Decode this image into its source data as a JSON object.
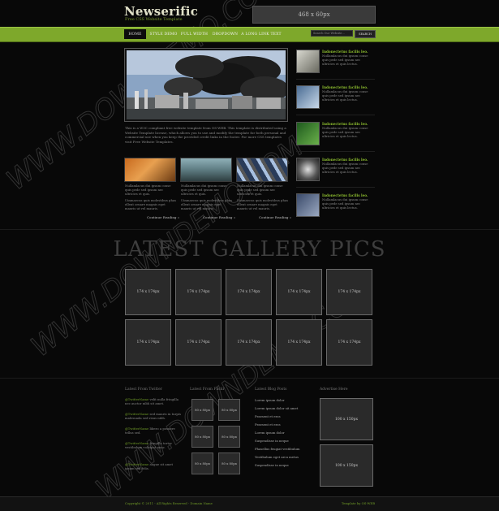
{
  "header": {
    "logo": "Newserific",
    "tagline": "Free CSS Website Template",
    "banner": "468 x 60px"
  },
  "nav": {
    "items": [
      "HOME",
      "STYLE DEMO",
      "FULL WIDTH",
      "DROPDOWN",
      "A LONG LINK TEXT"
    ],
    "search_placeholder": "Search Our Website...",
    "search_button": "SEARCH"
  },
  "intro": {
    "text": "This is a W3C compliant free website template from OS-WEB. This template is distributed using a Website Template license, which allows you to use and modify the template for both personal and commercial use when you keep the provided credit links in the footer. For more CSS templates visit Free Website Templates."
  },
  "columns": [
    {
      "p1": "Nullamlacus dui ipsum conse quis pede sed ipsum nec ultricies et quis.",
      "p2": "Uinmaecus quis molestibus phas ellent ornare magnis eget mauris ut vel mauris.",
      "more": "Continue Reading »"
    },
    {
      "p1": "Nullamlacus dui ipsum conse quis pede sed ipsum nec ultricies et quis.",
      "p2": "Uinmaecus quis molestibus phas ellent ornare magnis eget mauris ut vel mauris.",
      "more": "Continue Reading »"
    },
    {
      "p1": "Nullamlacus dui ipsum conse quis pede sed ipsum nec ultricies et quis.",
      "p2": "Uinmaecus quis molestibus phas ellent ornare magnis eget mauris ut vel mauris.",
      "more": "Continue Reading »"
    }
  ],
  "sidebar": [
    {
      "title": "Indonectetus facilis leo.",
      "text": "Nullamlacus dui ipsum conse quis pede sed ipsum nec ultricies et quis lectus."
    },
    {
      "title": "Indonectetus facilis leo.",
      "text": "Nullamlacus dui ipsum conse quis pede sed ipsum nec ultricies et quis lectus."
    },
    {
      "title": "Indonectetus facilis leo.",
      "text": "Nullamlacus dui ipsum conse quis pede sed ipsum nec ultricies et quis lectus."
    },
    {
      "title": "Indonectetus facilis leo.",
      "text": "Nullamlacus dui ipsum conse quis pede sed ipsum nec ultricies et quis lectus."
    },
    {
      "title": "Indonectetus facilis leo.",
      "text": "Nullamlacus dui ipsum conse quis pede sed ipsum nec ultricies et quis lectus."
    }
  ],
  "gallery": {
    "title": "LATEST GALLERY PICS",
    "box_label": "174 x 174px"
  },
  "footer_cols": {
    "twitter_title": "Latest From Twitter",
    "tweets": [
      {
        "user": "@TwitterName",
        "text": "velit nulla fringilla nec auctor nibh sit amet."
      },
      {
        "user": "@TwitterName",
        "text": "sed mauris in turpis malesuada sed risus nibh."
      },
      {
        "user": "@TwitterName",
        "text": "libero a posuere tellus sed."
      },
      {
        "user": "@TwitterName",
        "text": "fringilla tortor vestibulum volutpat nunc."
      },
      {
        "user": "@TwitterName",
        "text": "augue sit amet ipsum sed felis."
      }
    ],
    "flickr_title": "Latest From Flickr",
    "flickr_label": "80 x 80px",
    "blog_title": "Latest Blog Posts",
    "blog_items": [
      "Lorem ipsum dolor",
      "Lorem ipsum dolor sit amet",
      "Praesent et eros",
      "Praesent et eros",
      "Lorem ipsum dolor",
      "Suspendisse in neque",
      "Phasellus feugiat vestibulum",
      "Vestibulum eget arcu metus",
      "Suspendisse in neque"
    ],
    "adverts_title": "Advertise Here",
    "advert_label": "100 x 150px"
  },
  "footer": {
    "copyright": "Copyright © 2011 - All Rights Reserved - Domain Name",
    "credit": "Template by OS-WEB"
  },
  "watermark": "WWW.DOWNDEMO.COM"
}
